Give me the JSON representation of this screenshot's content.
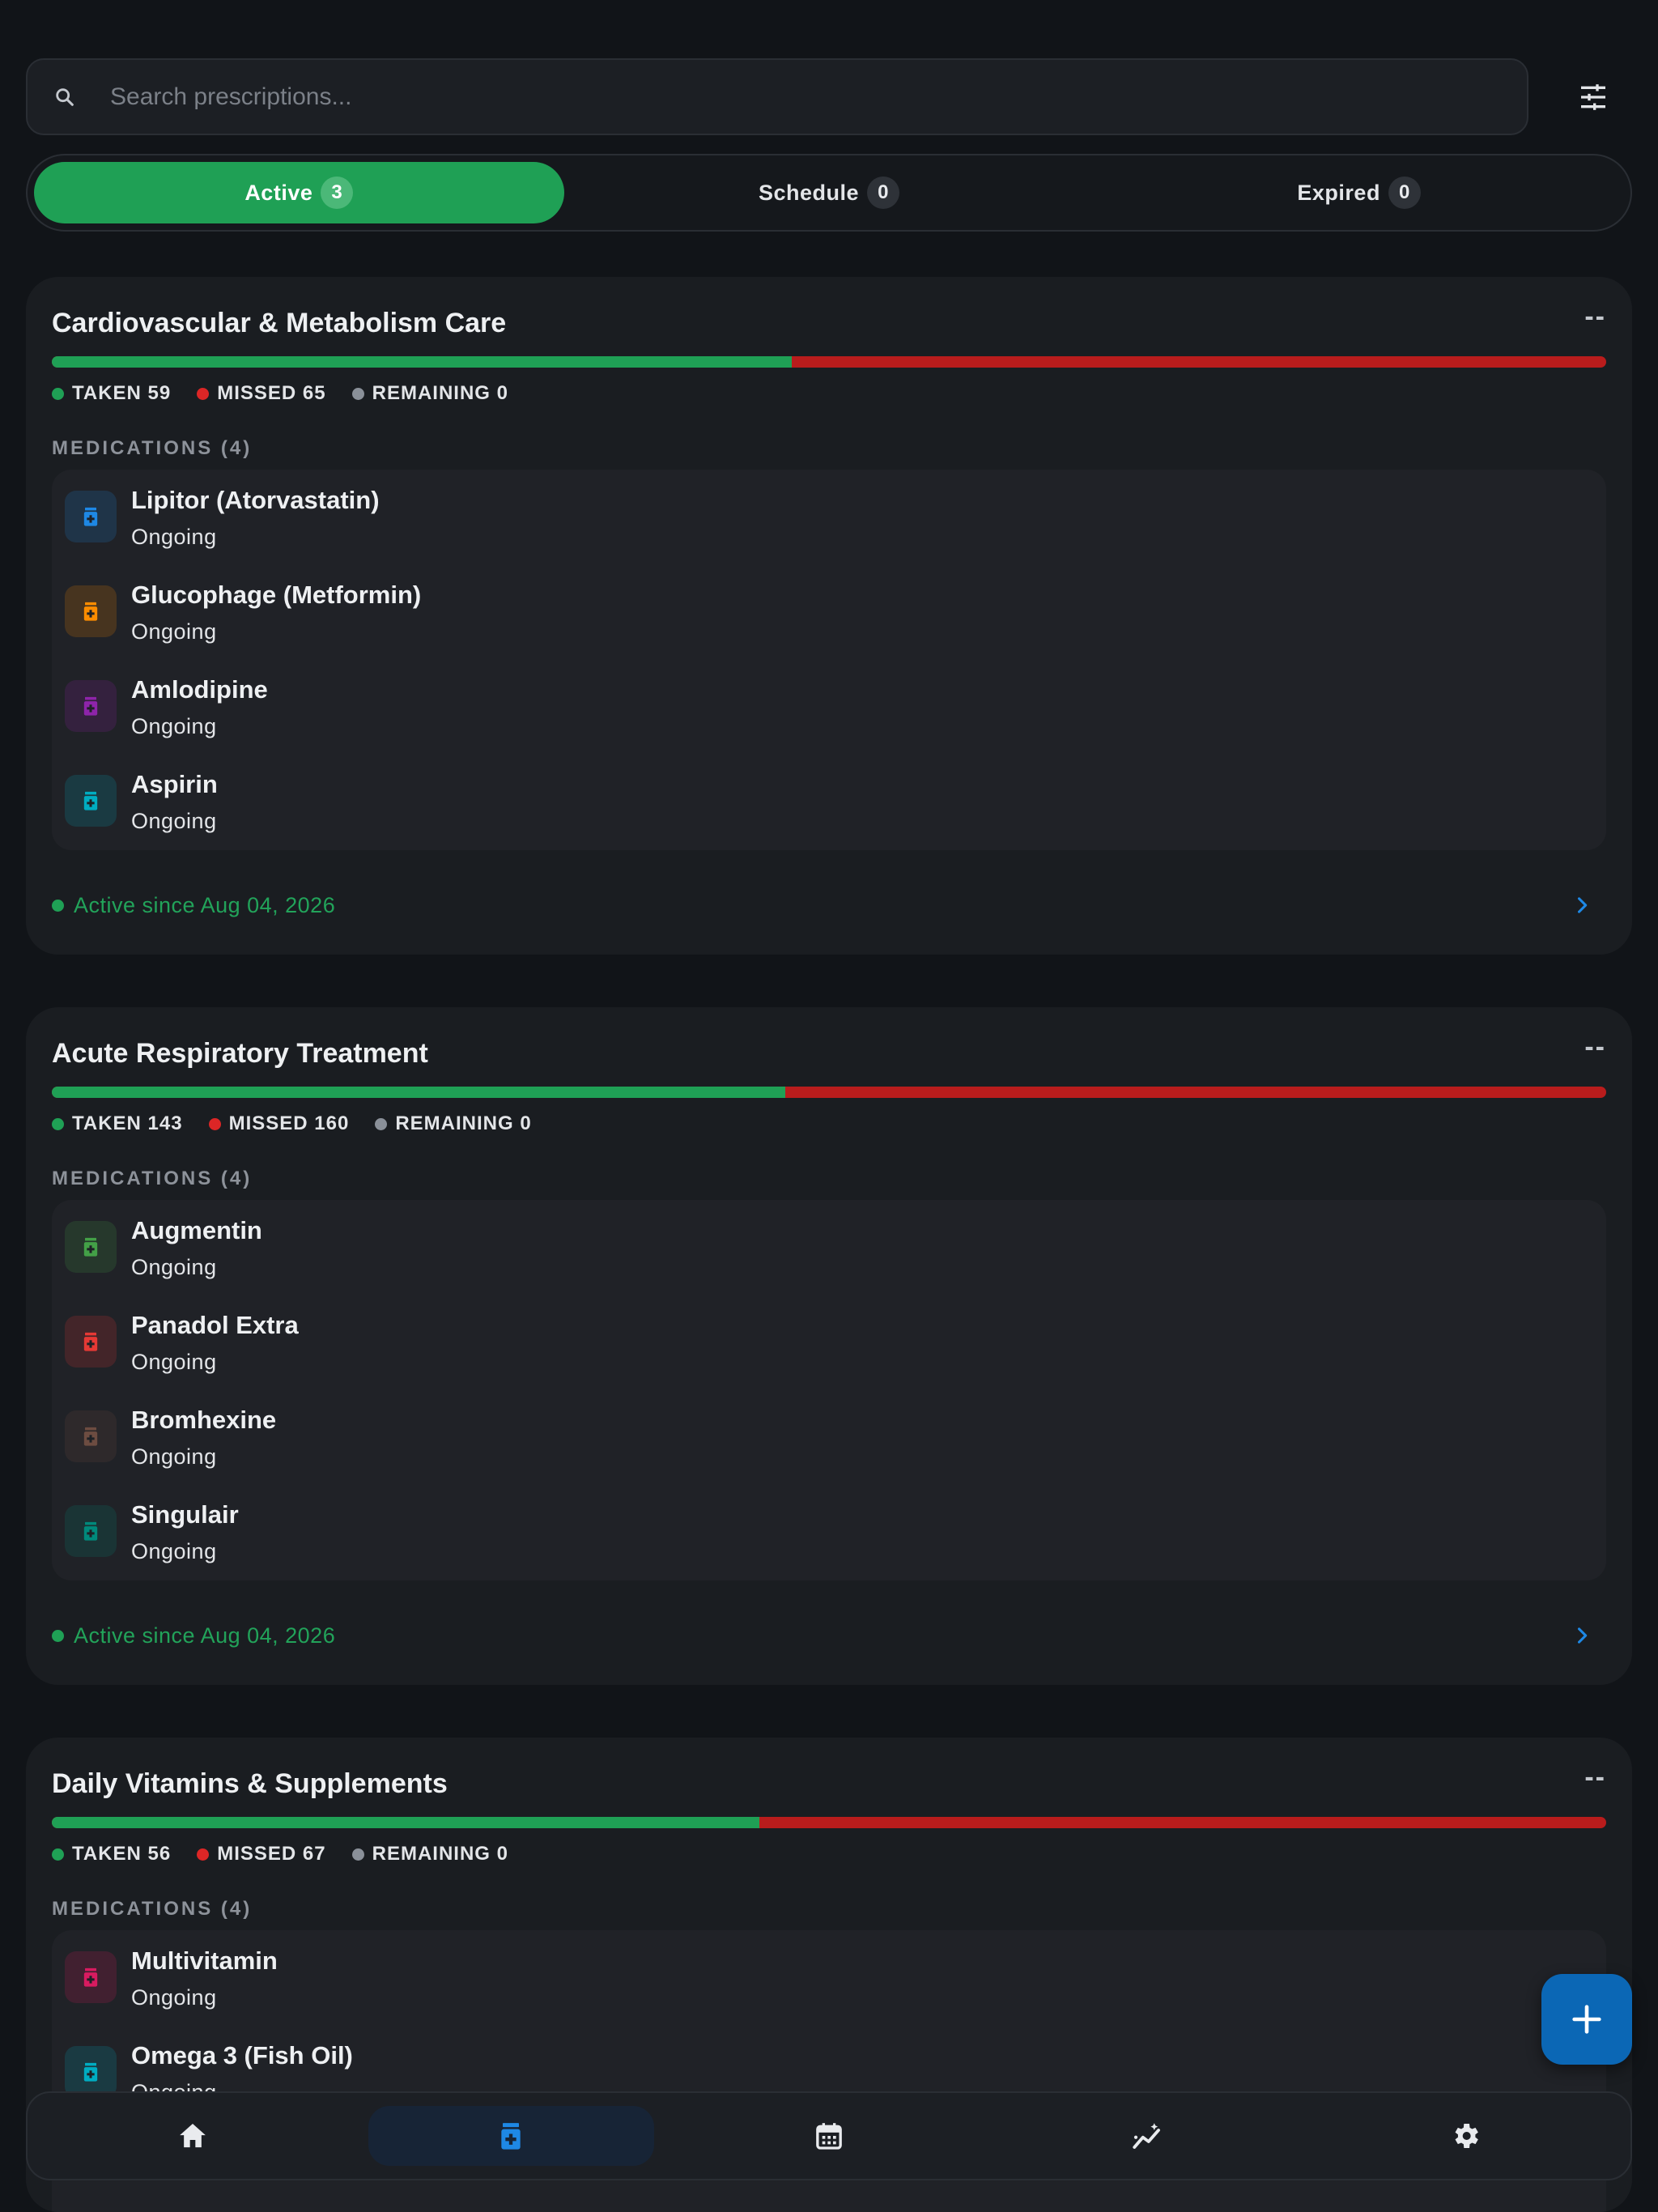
{
  "search": {
    "placeholder": "Search prescriptions..."
  },
  "tabs": [
    {
      "label": "Active",
      "count": "3",
      "active": true
    },
    {
      "label": "Schedule",
      "count": "0",
      "active": false
    },
    {
      "label": "Expired",
      "count": "0",
      "active": false
    }
  ],
  "cards": [
    {
      "title": "Cardiovascular & Metabolism Care",
      "menu": "--",
      "taken_fraction": 0.476,
      "stats": {
        "taken": "TAKEN 59",
        "missed": "MISSED 65",
        "remaining": "REMAINING 0"
      },
      "medications_label": "MEDICATIONS (4)",
      "medications": [
        {
          "name": "Lipitor (Atorvastatin)",
          "status": "Ongoing",
          "color": "#1e88e5"
        },
        {
          "name": "Glucophage (Metformin)",
          "status": "Ongoing",
          "color": "#fb8c00"
        },
        {
          "name": "Amlodipine",
          "status": "Ongoing",
          "color": "#8e24aa"
        },
        {
          "name": "Aspirin",
          "status": "Ongoing",
          "color": "#00acc1"
        }
      ],
      "footer": "Active since Aug 04, 2026"
    },
    {
      "title": "Acute Respiratory Treatment",
      "menu": "--",
      "taken_fraction": 0.472,
      "stats": {
        "taken": "TAKEN 143",
        "missed": "MISSED 160",
        "remaining": "REMAINING 0"
      },
      "medications_label": "MEDICATIONS (4)",
      "medications": [
        {
          "name": "Augmentin",
          "status": "Ongoing",
          "color": "#43a047"
        },
        {
          "name": "Panadol Extra",
          "status": "Ongoing",
          "color": "#e53935"
        },
        {
          "name": "Bromhexine",
          "status": "Ongoing",
          "color": "#6d4c41"
        },
        {
          "name": "Singulair",
          "status": "Ongoing",
          "color": "#00897b"
        }
      ],
      "footer": "Active since Aug 04, 2026"
    },
    {
      "title": "Daily Vitamins & Supplements",
      "menu": "--",
      "taken_fraction": 0.455,
      "stats": {
        "taken": "TAKEN 56",
        "missed": "MISSED 67",
        "remaining": "REMAINING 0"
      },
      "medications_label": "MEDICATIONS (4)",
      "medications": [
        {
          "name": "Multivitamin",
          "status": "Ongoing",
          "color": "#d81b60"
        },
        {
          "name": "Omega 3 (Fish Oil)",
          "status": "Ongoing",
          "color": "#00acc1"
        }
      ],
      "footer": ""
    }
  ],
  "nav": [
    {
      "icon": "home-icon",
      "active": false
    },
    {
      "icon": "medication-icon",
      "active": true
    },
    {
      "icon": "calendar-icon",
      "active": false
    },
    {
      "icon": "analytics-icon",
      "active": false
    },
    {
      "icon": "settings-icon",
      "active": false
    }
  ],
  "colors": {
    "accent_green": "#1fa055",
    "missed_red": "#b91c1c",
    "fab_blue": "#0b67b5"
  }
}
